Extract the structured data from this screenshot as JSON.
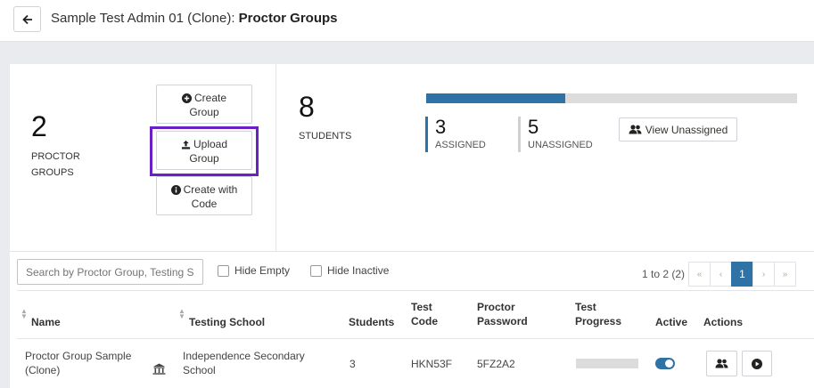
{
  "header": {
    "title_prefix": "Sample Test Admin 01 (Clone):",
    "title_bold": "Proctor Groups"
  },
  "summary": {
    "proctor_groups_count": "2",
    "proctor_groups_label_1": "PROCTOR",
    "proctor_groups_label_2": "GROUPS",
    "buttons": {
      "create_group": [
        "Create",
        "Group"
      ],
      "upload_group": [
        "Upload",
        "Group"
      ],
      "create_with_code": [
        "Create with",
        "Code"
      ]
    },
    "students_count": "8",
    "students_label": "STUDENTS",
    "assigned_fraction": 0.375,
    "assigned_count": "3",
    "assigned_label": "ASSIGNED",
    "unassigned_count": "5",
    "unassigned_label": "UNASSIGNED",
    "view_unassigned_label": "View Unassigned"
  },
  "filters": {
    "search_placeholder": "Search by Proctor Group, Testing School",
    "hide_empty_label": "Hide Empty",
    "hide_inactive_label": "Hide Inactive"
  },
  "pagination": {
    "range_text": "1 to 2 (2)",
    "first": "«",
    "prev": "‹",
    "current_page": "1",
    "next": "›",
    "last": "»"
  },
  "table": {
    "columns": {
      "name": "Name",
      "testing_school": "Testing School",
      "students": "Students",
      "test_code_1": "Test",
      "test_code_2": "Code",
      "proctor_password_1": "Proctor",
      "proctor_password_2": "Password",
      "test_progress_1": "Test",
      "test_progress_2": "Progress",
      "active": "Active",
      "actions": "Actions"
    },
    "rows": [
      {
        "name_1": "Proctor Group Sample",
        "name_2": "(Clone)",
        "school_1": "Independence Secondary",
        "school_2": "School",
        "students": "3",
        "test_code": "HKN53F",
        "proctor_password": "5FZ2A2",
        "test_progress_fraction": 0,
        "active": true
      }
    ]
  },
  "colors": {
    "accent": "#2f73a6",
    "highlight": "#6a1fc9"
  }
}
